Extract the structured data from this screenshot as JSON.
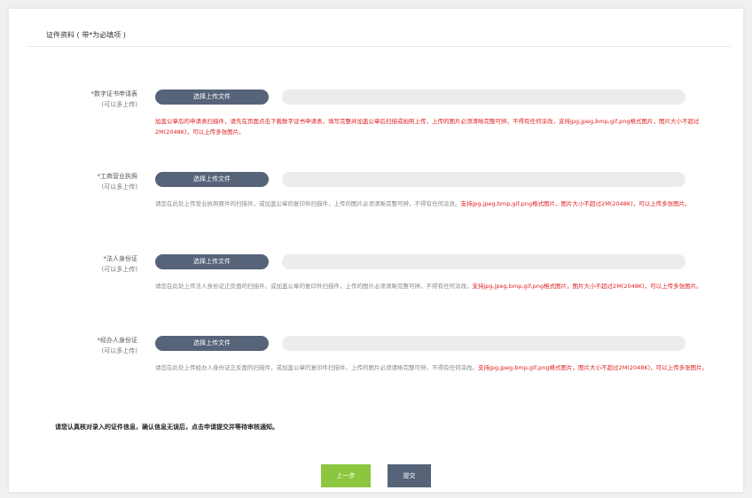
{
  "header": {
    "title": "证件资料 ( 带*为必填项 )"
  },
  "sections": [
    {
      "label": "*数字证书申请表",
      "sublabel": "(可以多上传)",
      "button": "选择上传文件",
      "hint_gray": "",
      "hint_red": "加盖公章后的申请表扫描件，请先在页面点击下载数字证书申请表，填写完整并加盖公章后扫描或拍照上传，上传的图片必须清晰完整可辨，不得有任何涂改，支持jpg,jpeg,bmp,gif,png格式图片，图片大小不超过2M(2048K)，可以上传多张图片。"
    },
    {
      "label": "*工商营业执照",
      "sublabel": "(可以多上传)",
      "button": "选择上传文件",
      "hint_gray": "请您在此处上传营业执照原件的扫描件，或加盖公章的复印件扫描件，上传的图片必须清晰完整可辨，不得有任何涂改。",
      "hint_red": "支持jpg,jpeg,bmp,gif,png格式图片，图片大小不超过2M(2048K)，可以上传多张图片。"
    },
    {
      "label": "*法人身份证",
      "sublabel": "(可以多上传)",
      "button": "选择上传文件",
      "hint_gray": "请您在此处上传法人身份证正反面的扫描件，或加盖公章的复印件扫描件，上传的图片必须清晰完整可辨，不得有任何涂改。",
      "hint_red": "支持jpg,jpeg,bmp,gif,png格式图片，图片大小不超过2M(2048K)，可以上传多张图片。"
    },
    {
      "label": "*经办人身份证",
      "sublabel": "(可以多上传)",
      "button": "选择上传文件",
      "hint_gray": "请您在此处上传经办人身份证正反面的扫描件，或加盖公章的复印件扫描件，上传的图片必须清晰完整可辨，不得有任何涂改。",
      "hint_red": "支持jpg,jpeg,bmp,gif,png格式图片，图片大小不超过2M(2048K)，可以上传多张图片。"
    }
  ],
  "note": "请您认真核对录入的证件信息，确认信息无误后，点击申请提交并等待审核通知。",
  "actions": {
    "prev": "上一步",
    "submit": "提交"
  },
  "colors": {
    "upload_button": "#566379",
    "prev_button": "#8cc63f",
    "submit_button": "#566379",
    "hint_red": "#e02020"
  }
}
